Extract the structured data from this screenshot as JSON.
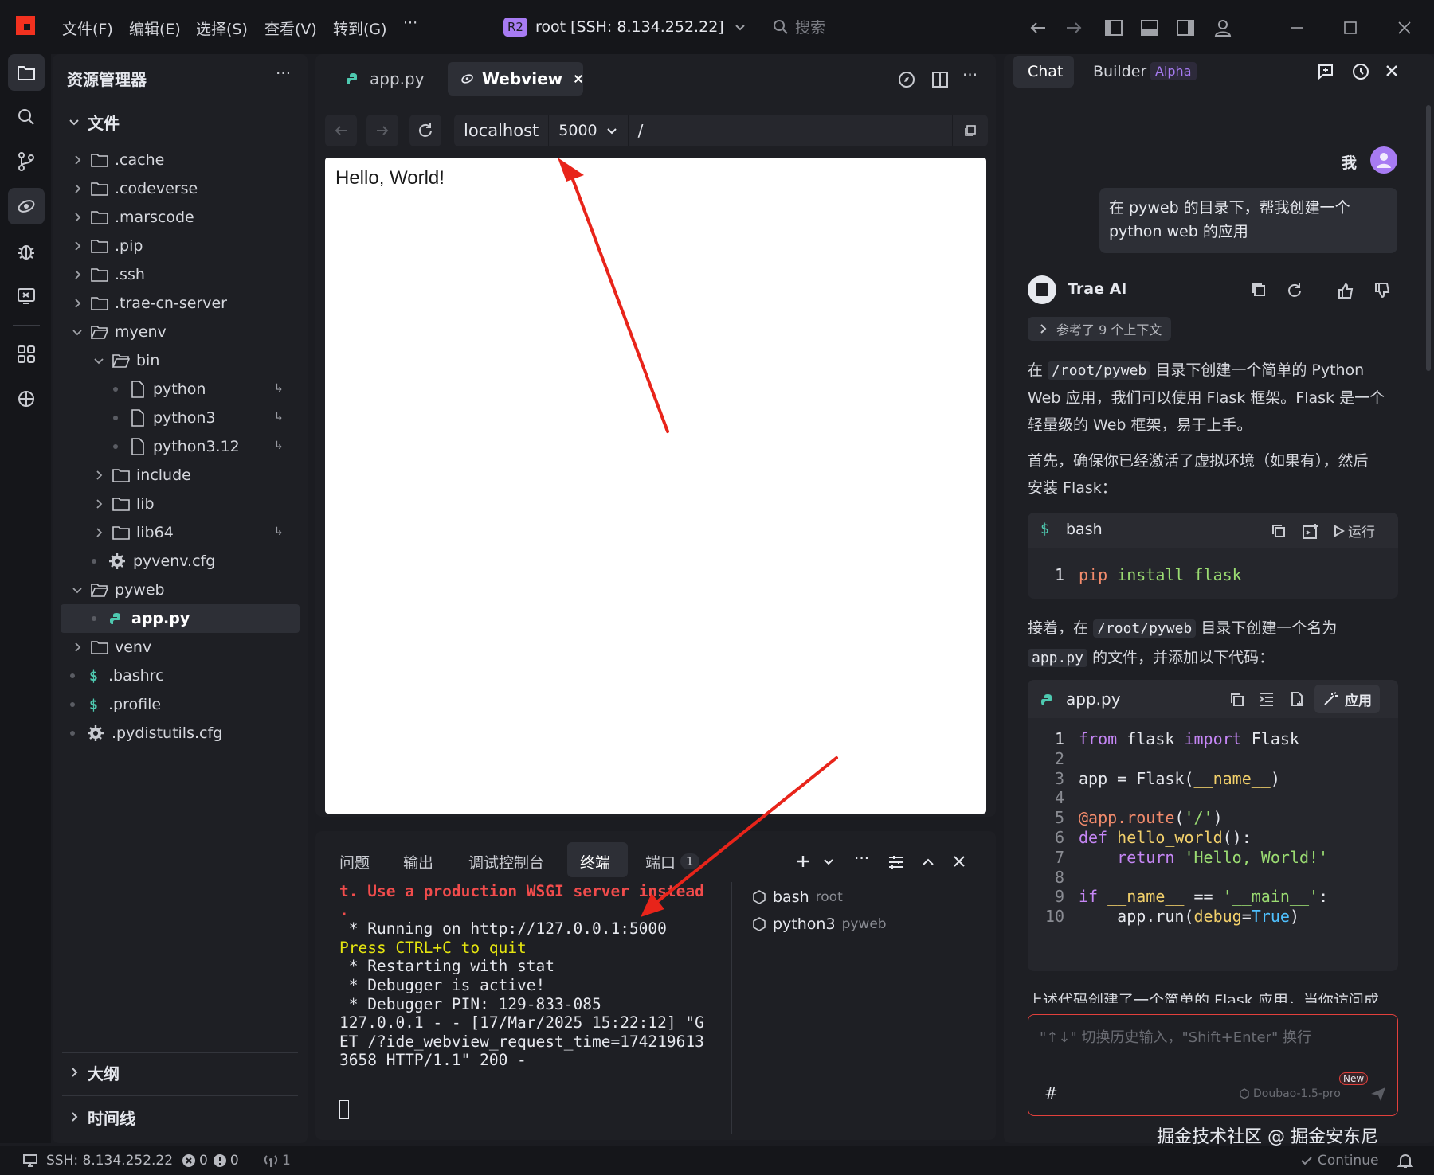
{
  "menu": {
    "file": "文件(F)",
    "edit": "编辑(E)",
    "select": "选择(S)",
    "view": "查看(V)",
    "goto": "转到(G)",
    "more": "···",
    "remote_badge": "R2",
    "remote_title": "root [SSH: 8.134.252.22]",
    "search_placeholder": "搜索"
  },
  "explorer": {
    "title": "资源管理器",
    "more": "···",
    "section": "文件",
    "items": [
      {
        "label": ".cache"
      },
      {
        "label": ".codeverse"
      },
      {
        "label": ".marscode"
      },
      {
        "label": ".pip"
      },
      {
        "label": ".ssh"
      },
      {
        "label": ".trae-cn-server"
      },
      {
        "label": "myenv"
      },
      {
        "label": "bin"
      },
      {
        "label": "python",
        "link_mark": "↳"
      },
      {
        "label": "python3",
        "link_mark": "↳"
      },
      {
        "label": "python3.12",
        "link_mark": "↳"
      },
      {
        "label": "include"
      },
      {
        "label": "lib"
      },
      {
        "label": "lib64",
        "link_mark": "↳"
      },
      {
        "label": "pyvenv.cfg"
      },
      {
        "label": "pyweb"
      },
      {
        "label": "app.py"
      },
      {
        "label": "venv"
      },
      {
        "label": ".bashrc"
      },
      {
        "label": ".profile"
      },
      {
        "label": ".pydistutils.cfg"
      }
    ],
    "outline": "大纲",
    "timeline": "时间线"
  },
  "editor": {
    "tab_file": "app.py",
    "tab_webview": "Webview",
    "url_host": "localhost",
    "url_port": "5000",
    "url_path": "/",
    "page_text": "Hello, World!"
  },
  "panel": {
    "tabs": {
      "problems": "问题",
      "output": "输出",
      "debug_console": "调试控制台",
      "terminal": "终端",
      "ports": "端口",
      "ports_count": "1"
    },
    "terminal_lines": [
      {
        "text": "t. Use a production WSGI server instead",
        "color": "#f14c4c",
        "bold": true
      },
      {
        "text": ".",
        "color": "#f14c4c",
        "bold": true
      },
      {
        "text": " * Running on http://127.0.0.1:5000",
        "color": "#e6e8ee",
        "bold": false
      },
      {
        "text": "Press CTRL+C to quit",
        "color": "#e5e510",
        "bold": false
      },
      {
        "text": " * Restarting with stat",
        "color": "#e6e8ee",
        "bold": false
      },
      {
        "text": " * Debugger is active!",
        "color": "#e6e8ee",
        "bold": false
      },
      {
        "text": " * Debugger PIN: 129-833-085",
        "color": "#e6e8ee",
        "bold": false
      },
      {
        "text": "127.0.0.1 - - [17/Mar/2025 15:22:12] \"G",
        "color": "#e6e8ee",
        "bold": false
      },
      {
        "text": "ET /?ide_webview_request_time=174219613",
        "color": "#e6e8ee",
        "bold": false
      },
      {
        "text": "3658 HTTP/1.1\" 200 -",
        "color": "#e6e8ee",
        "bold": false
      }
    ],
    "sessions": [
      {
        "name": "bash",
        "dir": "root"
      },
      {
        "name": "python3",
        "dir": "pyweb"
      }
    ]
  },
  "chat": {
    "tab_chat": "Chat",
    "tab_builder": "Builder",
    "builder_badge": "Alpha",
    "user_label": "我",
    "user_message_1": "在 pyweb 的目录下，帮我创建一个",
    "user_message_2": "python web 的应用",
    "ai_name": "Trae AI",
    "context_ref": "参考了 9 个上下文",
    "p1_a": "在",
    "p1_code": "/root/pyweb",
    "p1_b": "目录下创建一个简单的 Python",
    "p1_line2": "Web 应用，我们可以使用 Flask 框架。Flask 是一个",
    "p1_line3": "轻量级的 Web 框架，易于上手。",
    "p2_line1": "首先，确保你已经激活了虚拟环境（如果有），然后",
    "p2_line2": "安装 Flask：",
    "bash_block": {
      "lang": "bash",
      "run_label": "运行",
      "line_no": "1",
      "cmd": "pip",
      "args": "install flask"
    },
    "p3_a": "接着，在",
    "p3_code": "/root/pyweb",
    "p3_b": "目录下创建一个名为",
    "p3_code2": "app.py",
    "p3_c": "的文件，并添加以下代码：",
    "code_block": {
      "filename": "app.py",
      "apply_label": "应用",
      "lines": [
        "1",
        "2",
        "3",
        "4",
        "5",
        "6",
        "7",
        "8",
        "9",
        "10"
      ]
    },
    "truncated_line": "上述代码创建了一个简单的 Flask 应用，当你访问成",
    "input_placeholder": "\"↑↓\" 切换历史输入，\"Shift+Enter\" 换行",
    "hash": "#",
    "model": "Doubao-1.5-pro",
    "new_badge": "New"
  },
  "statusbar": {
    "ssh": "SSH: 8.134.252.22",
    "errors": "0",
    "warnings": "0",
    "ports": "1",
    "continue": "Continue"
  },
  "watermark": "掘金技术社区 @ 掘金安东尼",
  "colors": {
    "accent_red": "#f2311f",
    "annotation_arrow": "#e8241a",
    "python_icon": "#4ec9b0",
    "link_code": "#4fc1ff",
    "badge_purple": "#a77bf3"
  }
}
